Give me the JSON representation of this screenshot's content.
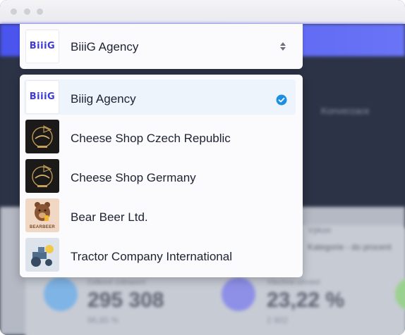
{
  "window": {
    "controls": [
      "close",
      "minimize",
      "maximize"
    ]
  },
  "background": {
    "tab_label": "Konverzace",
    "row1": "Výkon",
    "row2": "Kategorie - do procent",
    "stats": [
      {
        "label": "Celkové zobrazení",
        "value": "295 308",
        "sub": "96,85 %"
      },
      {
        "label": "Všechna uživatel",
        "value": "23,22 %",
        "sub": "2 902"
      }
    ]
  },
  "select": {
    "logo_text": "BiiiG",
    "value": "BiiiG Agency",
    "icon": "sort-arrows-icon"
  },
  "options": [
    {
      "label": "Biiig Agency",
      "logo": "biiig",
      "logo_text": "BiiiG",
      "selected": true
    },
    {
      "label": "Cheese Shop Czech Republic",
      "logo": "cheese",
      "selected": false
    },
    {
      "label": "Cheese Shop Germany",
      "logo": "cheese",
      "selected": false
    },
    {
      "label": "Bear Beer Ltd.",
      "logo": "bear",
      "logo_text": "BEARBEER",
      "selected": false
    },
    {
      "label": "Tractor Company International",
      "logo": "tractor",
      "selected": false
    }
  ],
  "colors": {
    "accent": "#1a8fe3",
    "brand_blue": "#4a54ee",
    "selected_bg": "#eef4fc"
  }
}
